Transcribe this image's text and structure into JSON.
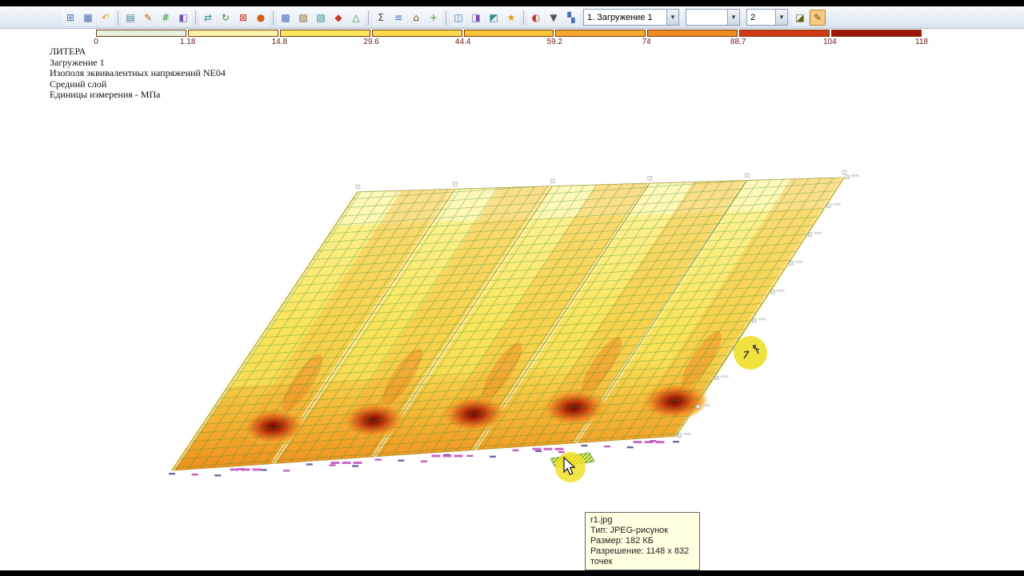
{
  "toolbar": {
    "icons_left": [
      {
        "name": "new-document-icon",
        "glyph": "⊞",
        "color": "#4a6fb5"
      },
      {
        "name": "open-project-icon",
        "glyph": "▦",
        "color": "#4a6fb5"
      },
      {
        "name": "undo-icon",
        "glyph": "↶",
        "color": "#dd9f10"
      },
      {
        "sep": true
      },
      {
        "name": "print-icon",
        "glyph": "▤",
        "color": "#3f7f9f"
      },
      {
        "name": "edit-icon",
        "glyph": "✎",
        "color": "#b06a10"
      },
      {
        "name": "grid-icon",
        "glyph": "#",
        "color": "#3f8f3f"
      },
      {
        "name": "fragment-icon",
        "glyph": "◧",
        "color": "#7a4fb0"
      },
      {
        "sep": true
      },
      {
        "name": "exchange-icon",
        "glyph": "⇄",
        "color": "#2f8f8f"
      },
      {
        "name": "refresh-icon",
        "glyph": "↻",
        "color": "#3f8f3f"
      },
      {
        "name": "delete-icon",
        "glyph": "⊠",
        "color": "#c0392b"
      },
      {
        "name": "node-icon",
        "glyph": "●",
        "color": "#d06010"
      },
      {
        "sep": true
      },
      {
        "name": "mesh-icon",
        "glyph": "▩",
        "color": "#4a6fb5"
      },
      {
        "name": "plate-icon",
        "glyph": "▨",
        "color": "#8a6a2a"
      },
      {
        "name": "section-icon",
        "glyph": "▧",
        "color": "#2f8f8f"
      },
      {
        "name": "load-icon",
        "glyph": "◆",
        "color": "#c0392b"
      },
      {
        "name": "support-icon",
        "glyph": "△",
        "color": "#3f8f3f"
      },
      {
        "sep": true
      },
      {
        "name": "sum-icon",
        "glyph": "Σ",
        "color": "#444444"
      },
      {
        "name": "table-icon",
        "glyph": "≡",
        "color": "#4a6fb5"
      },
      {
        "name": "model-icon",
        "glyph": "⌂",
        "color": "#8a4a10"
      },
      {
        "name": "add-icon",
        "glyph": "+",
        "color": "#3f8f3f"
      },
      {
        "sep": true
      },
      {
        "name": "view-xy-icon",
        "glyph": "◫",
        "color": "#4a6fb5"
      },
      {
        "name": "view-xz-icon",
        "glyph": "◨",
        "color": "#7a4fb0"
      },
      {
        "name": "view-yz-icon",
        "glyph": "◩",
        "color": "#2f8f8f"
      },
      {
        "name": "isometric-icon",
        "glyph": "★",
        "color": "#dd9f10"
      },
      {
        "sep": true
      },
      {
        "name": "mosaic-icon",
        "glyph": "◐",
        "color": "#c0392b"
      },
      {
        "name": "isofields-icon",
        "glyph": "▼",
        "color": "#555555"
      },
      {
        "name": "deformation-icon",
        "glyph": "▚",
        "color": "#4a6fb5"
      }
    ],
    "icons_right": [
      {
        "name": "animation-icon",
        "glyph": "◪",
        "color": "#6a5a10"
      },
      {
        "name": "result-pen-icon",
        "glyph": "✎",
        "color": "#6a5a10",
        "active": true
      }
    ],
    "combos": [
      {
        "name": "loadcase-combo",
        "value": "1. Загружение 1"
      },
      {
        "name": "mode-combo",
        "value": ""
      },
      {
        "name": "step-combo",
        "value": "2"
      }
    ]
  },
  "legend": {
    "ticks": [
      "0",
      "1.18",
      "14.8",
      "29.6",
      "44.4",
      "59.2",
      "74",
      "88.7",
      "104",
      "118"
    ],
    "colors": [
      "#e3f2e1",
      "#f9f3ae",
      "#f8e75d",
      "#fbd94a",
      "#f9c23a",
      "#f8a72e",
      "#ef8a20",
      "#d03915",
      "#9d1409"
    ]
  },
  "annotation": {
    "lines": [
      "ЛИТЕРА",
      "Загружение 1",
      "Изополя эквивалентных напряжений NE04",
      "Средний слой",
      "Единицы измерения - МПа"
    ]
  },
  "tooltip": {
    "filename": "r1.jpg",
    "lines": [
      "Тип: JPEG-рисунок",
      "Размер: 182 КБ",
      "Разрешение: 1148 x 832 точек"
    ]
  }
}
